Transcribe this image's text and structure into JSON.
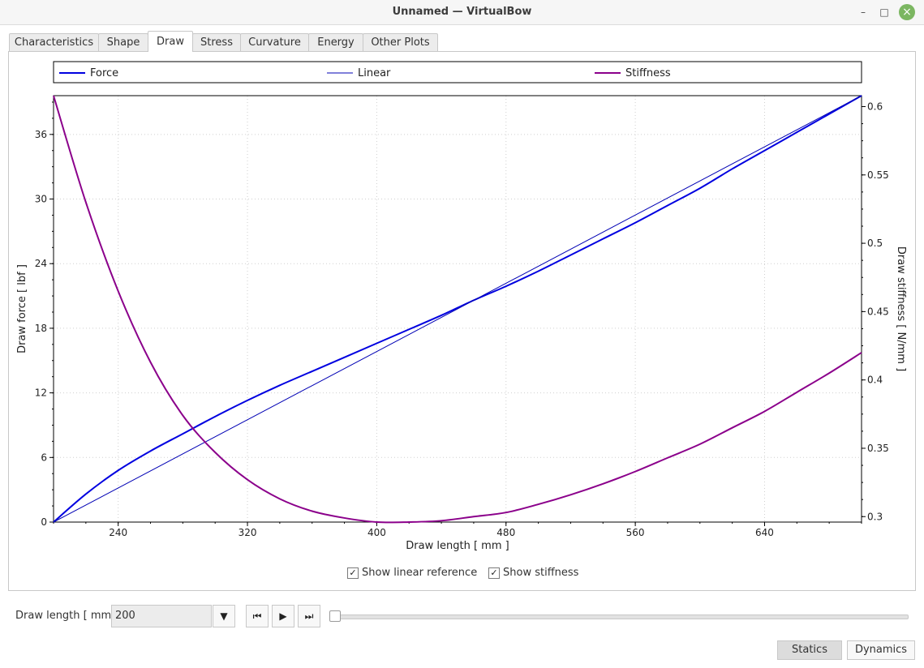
{
  "window": {
    "title": "Unnamed — VirtualBow"
  },
  "titlebar_glyphs": {
    "minimize": "–",
    "maximize": "□",
    "close": "×"
  },
  "tabs": [
    {
      "label": "Characteristics"
    },
    {
      "label": "Shape"
    },
    {
      "label": "Draw"
    },
    {
      "label": "Stress"
    },
    {
      "label": "Curvature"
    },
    {
      "label": "Energy"
    },
    {
      "label": "Other Plots"
    }
  ],
  "active_tab": "Draw",
  "options": {
    "show_linear_reference": {
      "label": "Show linear reference",
      "checked": true
    },
    "show_stiffness": {
      "label": "Show stiffness",
      "checked": true
    }
  },
  "draw_control": {
    "label": "Draw length [ mm ]",
    "value": "200",
    "slider_fraction": 0,
    "buttons": {
      "dropdown": "▼",
      "first": "⏮",
      "play": "▶",
      "last": "⏭"
    }
  },
  "bottom_buttons": {
    "statics": "Statics",
    "dynamics": "Dynamics"
  },
  "chart_data": {
    "type": "line",
    "xlabel": "Draw length [ mm ]",
    "ylabel": "Draw force [ lbf ]",
    "y2label": "Draw stiffness [ N/mm ]",
    "xlim": [
      200,
      700
    ],
    "ylim": [
      0,
      39.6
    ],
    "y2lim": [
      0.296,
      0.608
    ],
    "xticks": [
      240,
      320,
      400,
      480,
      560,
      640
    ],
    "yticks": [
      0,
      6,
      12,
      18,
      24,
      30,
      36
    ],
    "y2ticks": [
      0.3,
      0.35,
      0.4,
      0.45,
      0.5,
      0.55,
      0.6
    ],
    "ytick_labels": [
      "0",
      "6",
      "12",
      "18",
      "24",
      "30",
      "36"
    ],
    "y2tick_labels": [
      "0.3",
      "0.35",
      "0.4",
      "0.45",
      "0.5",
      "0.55",
      "0.6"
    ],
    "grid": true,
    "legend_position": "top",
    "series": [
      {
        "name": "Force",
        "axis": "left",
        "color": "#0000e0",
        "width": 2,
        "x": [
          200,
          220,
          240,
          260,
          280,
          300,
          320,
          340,
          360,
          380,
          400,
          420,
          440,
          460,
          480,
          500,
          520,
          540,
          560,
          580,
          600,
          620,
          640,
          660,
          680,
          700
        ],
        "y": [
          0,
          2.6,
          4.8,
          6.6,
          8.2,
          9.8,
          11.3,
          12.7,
          14.0,
          15.3,
          16.6,
          17.9,
          19.2,
          20.6,
          21.9,
          23.3,
          24.8,
          26.3,
          27.8,
          29.4,
          31.0,
          32.8,
          34.5,
          36.2,
          37.9,
          39.6
        ]
      },
      {
        "name": "Linear",
        "axis": "left",
        "color": "#0000b4",
        "width": 1,
        "x": [
          200,
          700
        ],
        "y": [
          0,
          39.6
        ]
      },
      {
        "name": "Stiffness",
        "axis": "right",
        "color": "#8b008b",
        "width": 2,
        "x": [
          200,
          220,
          240,
          260,
          280,
          300,
          320,
          340,
          360,
          380,
          400,
          420,
          440,
          460,
          480,
          500,
          520,
          540,
          560,
          580,
          600,
          620,
          640,
          660,
          680,
          700
        ],
        "y": [
          0.608,
          0.53,
          0.465,
          0.413,
          0.374,
          0.347,
          0.327,
          0.313,
          0.304,
          0.299,
          0.296,
          0.296,
          0.297,
          0.3,
          0.303,
          0.309,
          0.316,
          0.324,
          0.333,
          0.343,
          0.353,
          0.365,
          0.377,
          0.391,
          0.405,
          0.42
        ]
      }
    ]
  }
}
